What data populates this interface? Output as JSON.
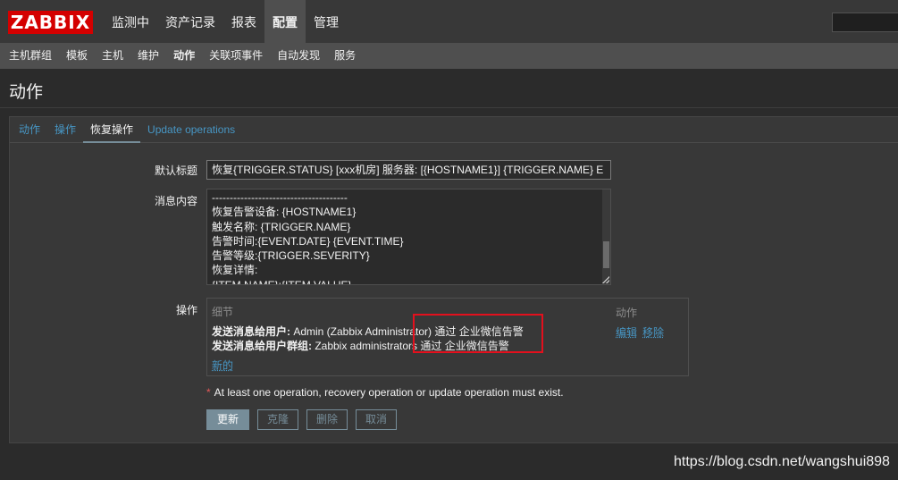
{
  "header": {
    "logo": "ZABBIX",
    "main_menu": [
      {
        "label": "监测中"
      },
      {
        "label": "资产记录"
      },
      {
        "label": "报表"
      },
      {
        "label": "配置"
      },
      {
        "label": "管理"
      }
    ],
    "sub_menu": [
      {
        "label": "主机群组"
      },
      {
        "label": "模板"
      },
      {
        "label": "主机"
      },
      {
        "label": "维护"
      },
      {
        "label": "动作"
      },
      {
        "label": "关联项事件"
      },
      {
        "label": "自动发现"
      },
      {
        "label": "服务"
      }
    ]
  },
  "page": {
    "title": "动作"
  },
  "tabs": [
    {
      "label": "动作"
    },
    {
      "label": "操作"
    },
    {
      "label": "恢复操作"
    },
    {
      "label": "Update operations"
    }
  ],
  "form": {
    "subject_label": "默认标题",
    "subject_value": "恢复{TRIGGER.STATUS}  [xxx机房] 服务器: [{HOSTNAME1}] {TRIGGER.NAME} E",
    "message_label": "消息内容",
    "message_lines": [
      "--------------------------------------",
      "恢复告警设备: {HOSTNAME1}",
      "触发名称: {TRIGGER.NAME}",
      "告警时间:{EVENT.DATE} {EVENT.TIME}",
      "告警等级:{TRIGGER.SEVERITY}",
      "恢复详情:",
      "{ITEM.NAME}:{ITEM.VALUE}"
    ],
    "operations_label": "操作",
    "operations": {
      "col_detail": "细节",
      "col_action": "动作",
      "rows": [
        {
          "bold": "发送消息给用户:",
          "text": " Admin (Zabbix Administrator) 通过 企业微信告警"
        },
        {
          "bold": "发送消息给用户群组:",
          "text": " Zabbix administrators 通过 企业微信告警"
        }
      ],
      "edit_label": "编辑",
      "remove_label": "移除",
      "new_label": "新的"
    },
    "note_star": "*",
    "note": "At least one operation, recovery operation or update operation must exist.",
    "buttons": {
      "update": "更新",
      "clone": "克隆",
      "delete": "删除",
      "cancel": "取消"
    }
  },
  "watermark": "https://blog.csdn.net/wangshui898",
  "colors": {
    "logo_bg": "#d40000",
    "link": "#4796c4",
    "primary_button": "#768d99",
    "highlight_box": "#e3101d"
  }
}
